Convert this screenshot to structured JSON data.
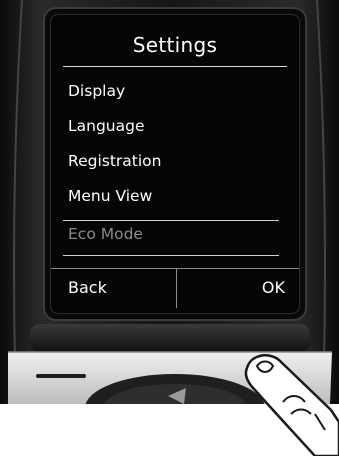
{
  "screen": {
    "title": "Settings",
    "menu_items": [
      {
        "label": "Display",
        "enabled": true
      },
      {
        "label": "Language",
        "enabled": true
      },
      {
        "label": "Registration",
        "enabled": true
      },
      {
        "label": "Menu View",
        "enabled": true
      },
      {
        "label": "Eco Mode",
        "enabled": false
      }
    ],
    "selected_index": 4
  },
  "softkeys": {
    "left_label": "Back",
    "right_label": "OK"
  },
  "colors": {
    "handset_body": "#1a1a1a",
    "display_background": "#050505",
    "display_text": "#ffffff",
    "disabled_text": "#8a8a8a",
    "keypad": "#d6d6d6"
  }
}
